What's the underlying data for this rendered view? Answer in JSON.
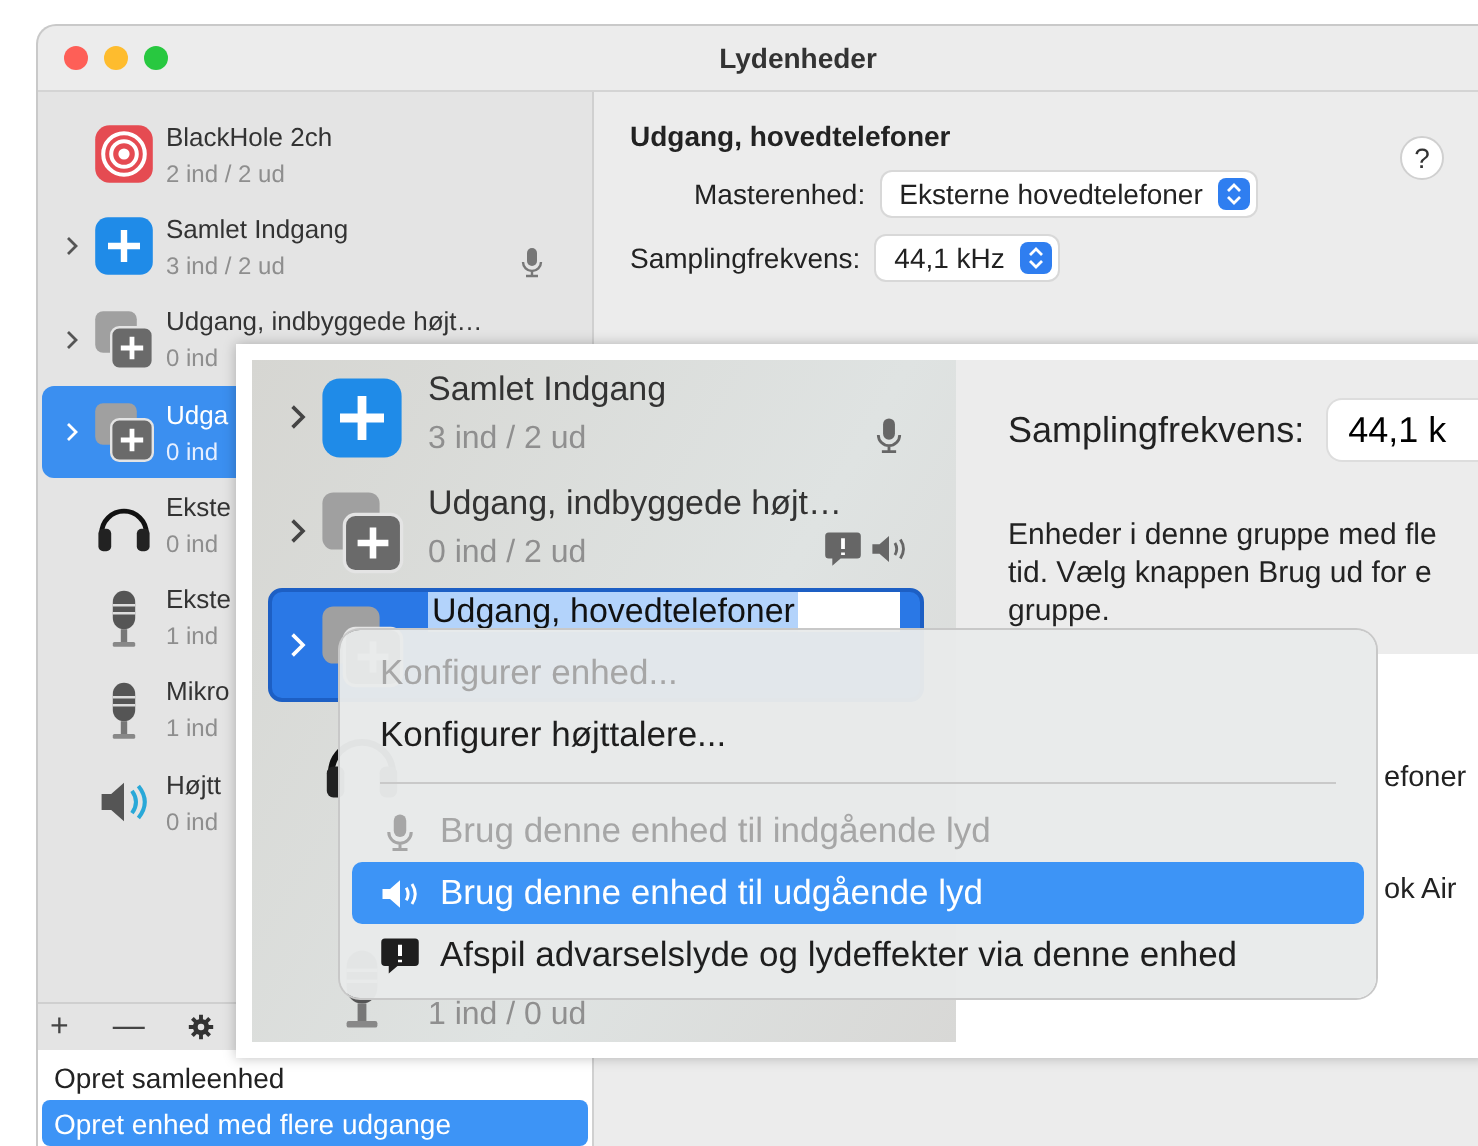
{
  "window": {
    "title": "Lydenheder"
  },
  "sidebar": {
    "devices": [
      {
        "name": "BlackHole 2ch",
        "channels": "2 ind / 2 ud",
        "kind": "target",
        "expandable": false,
        "selected": false
      },
      {
        "name": "Samlet Indgang",
        "channels": "3 ind / 2 ud",
        "kind": "plus",
        "expandable": true,
        "selected": false,
        "badges": [
          {
            "kind": "mic"
          }
        ]
      },
      {
        "name": "Udgang, indbyggede højt…",
        "channels": "0 ind",
        "kind": "stack",
        "expandable": true,
        "selected": false
      },
      {
        "name": "Udga",
        "channels": "0 ind",
        "kind": "stack",
        "expandable": true,
        "selected": true
      },
      {
        "name": "Ekste",
        "channels": "0 ind",
        "kind": "headphones",
        "expandable": false,
        "selected": false
      },
      {
        "name": "Ekste",
        "channels": "1 ind",
        "kind": "mic",
        "expandable": false,
        "selected": false
      },
      {
        "name": "Mikro",
        "channels": "1 ind",
        "kind": "mic",
        "expandable": false,
        "selected": false
      },
      {
        "name": "Højtt",
        "channels": "0 ind",
        "kind": "speaker",
        "expandable": false,
        "selected": false
      }
    ],
    "toolbar": [
      "+",
      "—"
    ],
    "add_menu": [
      {
        "label": "Opret samleenhed",
        "selected": false
      },
      {
        "label": "Opret enhed med flere udgange",
        "selected": true
      }
    ]
  },
  "detail": {
    "title": "Udgang, hovedtelefoner",
    "help": "?",
    "master_label": "Masterenhed:",
    "master_value": "Eksterne hovedtelefoner",
    "rate_label": "Samplingfrekvens:",
    "rate_value": "44,1 kHz"
  },
  "zoom_inset": {
    "devices": [
      {
        "name": "Samlet Indgang",
        "channels": "3 ind / 2 ud",
        "kind": "plus",
        "expandable": true,
        "selected": false,
        "editing": false,
        "badges": [
          {
            "kind": "mic"
          }
        ]
      },
      {
        "name": "Udgang, indbyggede højt…",
        "channels": "0 ind / 2 ud",
        "kind": "stack",
        "expandable": true,
        "selected": false,
        "editing": false,
        "badges": [
          {
            "kind": "alert"
          },
          {
            "kind": "speaker"
          }
        ]
      },
      {
        "name": "Udgang, hovedtelefoner",
        "kind": "stack",
        "expandable": true,
        "selected": true,
        "editing": true
      },
      {
        "kind": "headphones"
      },
      {
        "channels": "1 ind / 0 ud",
        "kind": "mic"
      }
    ],
    "rate_label": "Samplingfrekvens:",
    "rate_value": "44,1 k",
    "description": [
      "Enheder i denne gruppe med fle",
      "tid. Vælg knappen Brug ud for e",
      "gruppe."
    ],
    "table_cells": [
      "efoner",
      "ok Air"
    ],
    "context_menu": [
      {
        "kind": "item",
        "label": "Konfigurer enhed...",
        "disabled": true,
        "selected": false
      },
      {
        "kind": "item",
        "label": "Konfigurer højttalere...",
        "disabled": false,
        "selected": false
      },
      {
        "kind": "separator"
      },
      {
        "kind": "item",
        "label": "Brug denne enhed til indgående lyd",
        "icon": {
          "kind": "mic"
        },
        "disabled": true,
        "selected": false
      },
      {
        "kind": "item",
        "label": "Brug denne enhed til udgående lyd",
        "icon": {
          "kind": "speaker"
        },
        "disabled": false,
        "selected": true
      },
      {
        "kind": "item",
        "label": "Afspil advarselslyde og lydeffekter via denne enhed",
        "icon": {
          "kind": "alert"
        },
        "disabled": false,
        "selected": false
      }
    ]
  }
}
